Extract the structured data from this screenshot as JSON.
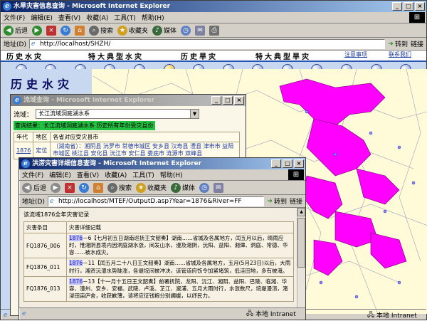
{
  "main_window": {
    "title": "水旱灾害信息查询 - Microsoft Internet Explorer",
    "menu": [
      "文件(F)",
      "编辑(E)",
      "查看(V)",
      "收藏(A)",
      "工具(T)",
      "帮助(H)"
    ],
    "toolbar": {
      "back": "后退",
      "search": "搜索",
      "favorites": "收藏夹",
      "media": "媒体"
    },
    "address_label": "地址(D)",
    "address_value": "http://localhost/SHZH/",
    "go": "转到",
    "links": "链接",
    "nav": [
      "历史水灾",
      "特大典型水灾",
      "历史旱灾",
      "特大典型旱灾",
      "注意事项",
      "联系我们"
    ],
    "page_title": "历史水灾",
    "status_zone": "本地 Intranet"
  },
  "query_window": {
    "title": "流域查询 - Microsoft Internet Explorer",
    "basin_label": "流域：",
    "basin_value": "长江流域洞庭湖水系",
    "result_header": "查询结果：长江流域洞庭湖水系 历史所有年份受灾县份",
    "columns": [
      "年代",
      "地区",
      "各省对应受灾县市"
    ],
    "row": {
      "year": "1876",
      "region": "定位",
      "counties": "（湖南省）：湘阴县 沅罗市 常德市城区 安乡县 汉寿县 澧县 津市市 益阳市城区 桃江县 安化县 沅江市 安仁县 娄底市 涟源市 双峰县"
    }
  },
  "detail_window": {
    "title": "洪涝灾害详细信息查询 - Microsoft Internet Explorer",
    "menu": [
      "文件(F)",
      "编辑(E)",
      "查看(V)",
      "收藏(A)",
      "工具(T)",
      "帮助(H)"
    ],
    "toolbar": {
      "back": "后退",
      "search": "搜索",
      "favorites": "收藏夹",
      "media": "媒体"
    },
    "address_label": "地址(D)",
    "address_value": "http://localhost/MTEF/OutputD.asp?Year=1876&River=FF",
    "go": "转到",
    "links": "链接",
    "heading": "该流域1876全年灾害记录",
    "columns": [
      "灾害条目",
      "灾害详细记载"
    ],
    "rows": [
      {
        "id": "FQ1876_006",
        "year": "1876",
        "text": "－6【七月初五日湖南巡抚王文韶奏】湖南……省城及各属地方，闰五月以后，晴雨应时，惟湘阴县境内因洞庭湖水涨，间发山水，漫及湘阴，沅阳、益阳、湘潭、洞庭、常德、华容……被水成灾。"
      },
      {
        "id": "FQ1876_011",
        "year": "1876",
        "text": "－11【闰五月二十八日王文韶奏】湖南……省城及各属地方，五月(5月23日)以后，大雨时行，湘资沅澧水势陡涨，各堤垸间被冲决，该管道府饬令加紧堵筑，低洼田地，多有被淹。"
      },
      {
        "id": "FQ1876_013",
        "year": "1876",
        "text": "－13【十一月十五日王文韶奏】前署抚院，龙阳、沅江、湘阴、益阳、巴陵、临湘、华容、澧州、安乡、安福、武陵、卢溪、芷江、溆浦、五月大雨时行，水涨数尺，垸堤漫溃，淹浸田亩庐舍，收获歉薄，请将应征钱粮分别蠲缓，以纾民力。"
      }
    ],
    "status_zone": "本地 Intranet"
  }
}
